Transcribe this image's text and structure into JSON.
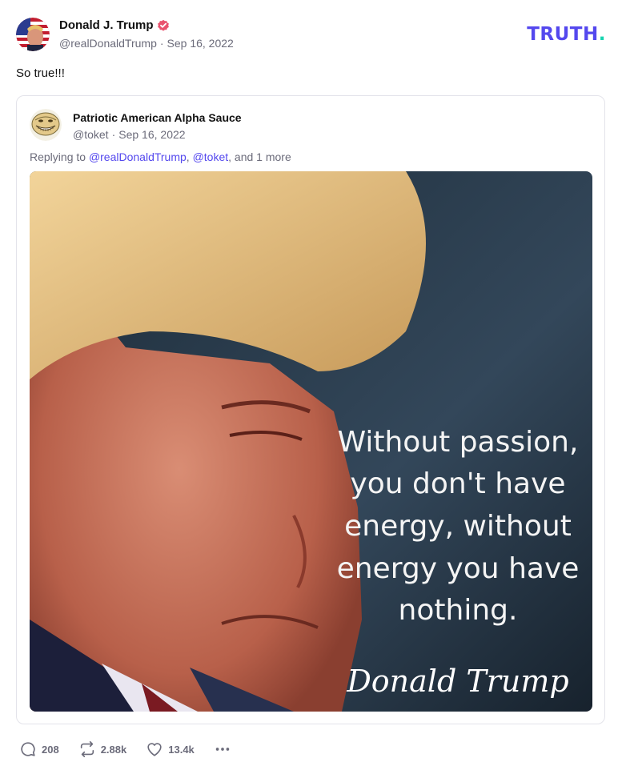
{
  "post": {
    "author_name": "Donald J. Trump",
    "handle": "@realDonaldTrump",
    "separator": "·",
    "date": "Sep 16, 2022",
    "text": "So true!!!"
  },
  "brand": {
    "logo_text": "TRUTH",
    "logo_dot": ".",
    "primary_color": "#5448ee",
    "accent_color": "#17d4b0"
  },
  "quoted": {
    "author_name": "Patriotic American Alpha Sauce",
    "handle": "@toket",
    "separator": "·",
    "date": "Sep 16, 2022",
    "replying_prefix": "Replying to ",
    "mention1": "@realDonaldTrump",
    "comma": ", ",
    "mention2": "@toket",
    "replying_suffix": ", and 1 more",
    "image": {
      "quote_lines": [
        "Without passion,",
        "you don't have",
        "energy, without",
        "energy you have",
        "nothing."
      ],
      "signature": "Donald Trump"
    }
  },
  "actions": {
    "replies": "208",
    "retruths": "2.88k",
    "likes": "13.4k"
  },
  "icons": [
    "verified-badge-icon",
    "reply-icon",
    "retruth-icon",
    "like-icon",
    "more-icon"
  ]
}
